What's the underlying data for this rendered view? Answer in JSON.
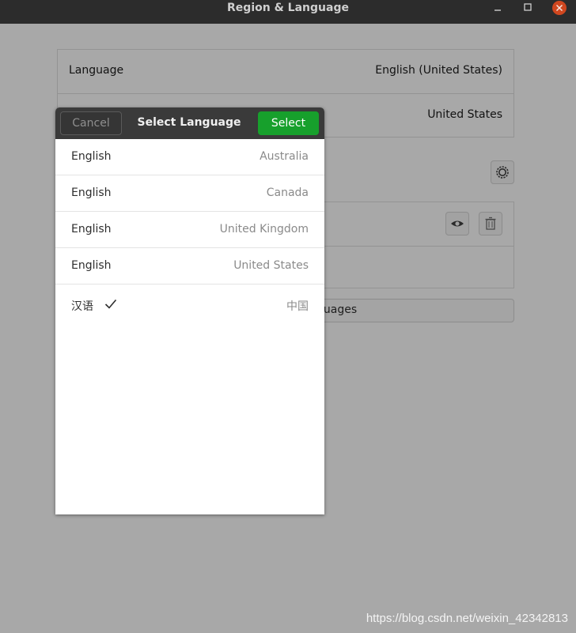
{
  "window": {
    "title": "Region & Language",
    "controls": [
      "minimize-icon",
      "maximize-icon",
      "close-icon"
    ]
  },
  "background": {
    "rows": [
      {
        "label": "Language",
        "value": "English (United States)"
      },
      {
        "label": "",
        "value": "United States"
      }
    ],
    "manage_button_partial": "guages",
    "icons": [
      "gear-icon",
      "eye-icon",
      "trash-icon"
    ]
  },
  "dialog": {
    "title": "Select Language",
    "cancel_label": "Cancel",
    "select_label": "Select",
    "items": [
      {
        "language": "English",
        "region": "Australia"
      },
      {
        "language": "English",
        "region": "Canada"
      },
      {
        "language": "English",
        "region": "United Kingdom"
      },
      {
        "language": "English",
        "region": "United States"
      },
      {
        "language": "汉语",
        "region": "中国",
        "selected": true
      }
    ]
  },
  "watermark": "https://blog.csdn.net/weixin_42342813",
  "colors": {
    "accent_select": "#17a02c",
    "header_bg": "#3a3a3a",
    "close_button": "#d0471f"
  }
}
